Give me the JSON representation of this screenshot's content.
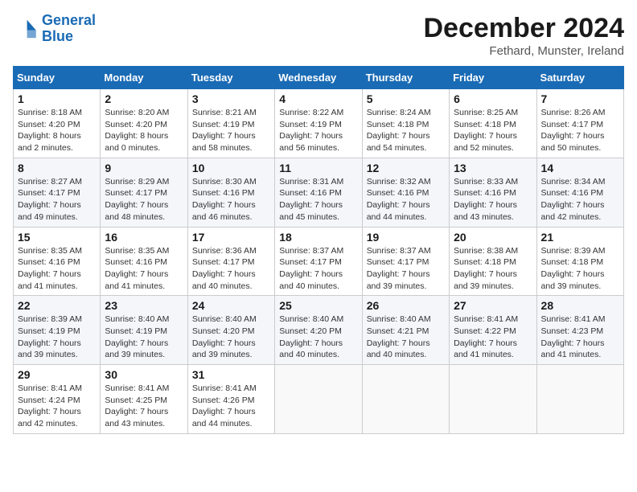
{
  "logo": {
    "line1": "General",
    "line2": "Blue"
  },
  "title": "December 2024",
  "location": "Fethard, Munster, Ireland",
  "days_of_week": [
    "Sunday",
    "Monday",
    "Tuesday",
    "Wednesday",
    "Thursday",
    "Friday",
    "Saturday"
  ],
  "weeks": [
    [
      {
        "day": "1",
        "info": "Sunrise: 8:18 AM\nSunset: 4:20 PM\nDaylight: 8 hours\nand 2 minutes."
      },
      {
        "day": "2",
        "info": "Sunrise: 8:20 AM\nSunset: 4:20 PM\nDaylight: 8 hours\nand 0 minutes."
      },
      {
        "day": "3",
        "info": "Sunrise: 8:21 AM\nSunset: 4:19 PM\nDaylight: 7 hours\nand 58 minutes."
      },
      {
        "day": "4",
        "info": "Sunrise: 8:22 AM\nSunset: 4:19 PM\nDaylight: 7 hours\nand 56 minutes."
      },
      {
        "day": "5",
        "info": "Sunrise: 8:24 AM\nSunset: 4:18 PM\nDaylight: 7 hours\nand 54 minutes."
      },
      {
        "day": "6",
        "info": "Sunrise: 8:25 AM\nSunset: 4:18 PM\nDaylight: 7 hours\nand 52 minutes."
      },
      {
        "day": "7",
        "info": "Sunrise: 8:26 AM\nSunset: 4:17 PM\nDaylight: 7 hours\nand 50 minutes."
      }
    ],
    [
      {
        "day": "8",
        "info": "Sunrise: 8:27 AM\nSunset: 4:17 PM\nDaylight: 7 hours\nand 49 minutes."
      },
      {
        "day": "9",
        "info": "Sunrise: 8:29 AM\nSunset: 4:17 PM\nDaylight: 7 hours\nand 48 minutes."
      },
      {
        "day": "10",
        "info": "Sunrise: 8:30 AM\nSunset: 4:16 PM\nDaylight: 7 hours\nand 46 minutes."
      },
      {
        "day": "11",
        "info": "Sunrise: 8:31 AM\nSunset: 4:16 PM\nDaylight: 7 hours\nand 45 minutes."
      },
      {
        "day": "12",
        "info": "Sunrise: 8:32 AM\nSunset: 4:16 PM\nDaylight: 7 hours\nand 44 minutes."
      },
      {
        "day": "13",
        "info": "Sunrise: 8:33 AM\nSunset: 4:16 PM\nDaylight: 7 hours\nand 43 minutes."
      },
      {
        "day": "14",
        "info": "Sunrise: 8:34 AM\nSunset: 4:16 PM\nDaylight: 7 hours\nand 42 minutes."
      }
    ],
    [
      {
        "day": "15",
        "info": "Sunrise: 8:35 AM\nSunset: 4:16 PM\nDaylight: 7 hours\nand 41 minutes."
      },
      {
        "day": "16",
        "info": "Sunrise: 8:35 AM\nSunset: 4:16 PM\nDaylight: 7 hours\nand 41 minutes."
      },
      {
        "day": "17",
        "info": "Sunrise: 8:36 AM\nSunset: 4:17 PM\nDaylight: 7 hours\nand 40 minutes."
      },
      {
        "day": "18",
        "info": "Sunrise: 8:37 AM\nSunset: 4:17 PM\nDaylight: 7 hours\nand 40 minutes."
      },
      {
        "day": "19",
        "info": "Sunrise: 8:37 AM\nSunset: 4:17 PM\nDaylight: 7 hours\nand 39 minutes."
      },
      {
        "day": "20",
        "info": "Sunrise: 8:38 AM\nSunset: 4:18 PM\nDaylight: 7 hours\nand 39 minutes."
      },
      {
        "day": "21",
        "info": "Sunrise: 8:39 AM\nSunset: 4:18 PM\nDaylight: 7 hours\nand 39 minutes."
      }
    ],
    [
      {
        "day": "22",
        "info": "Sunrise: 8:39 AM\nSunset: 4:19 PM\nDaylight: 7 hours\nand 39 minutes."
      },
      {
        "day": "23",
        "info": "Sunrise: 8:40 AM\nSunset: 4:19 PM\nDaylight: 7 hours\nand 39 minutes."
      },
      {
        "day": "24",
        "info": "Sunrise: 8:40 AM\nSunset: 4:20 PM\nDaylight: 7 hours\nand 39 minutes."
      },
      {
        "day": "25",
        "info": "Sunrise: 8:40 AM\nSunset: 4:20 PM\nDaylight: 7 hours\nand 40 minutes."
      },
      {
        "day": "26",
        "info": "Sunrise: 8:40 AM\nSunset: 4:21 PM\nDaylight: 7 hours\nand 40 minutes."
      },
      {
        "day": "27",
        "info": "Sunrise: 8:41 AM\nSunset: 4:22 PM\nDaylight: 7 hours\nand 41 minutes."
      },
      {
        "day": "28",
        "info": "Sunrise: 8:41 AM\nSunset: 4:23 PM\nDaylight: 7 hours\nand 41 minutes."
      }
    ],
    [
      {
        "day": "29",
        "info": "Sunrise: 8:41 AM\nSunset: 4:24 PM\nDaylight: 7 hours\nand 42 minutes."
      },
      {
        "day": "30",
        "info": "Sunrise: 8:41 AM\nSunset: 4:25 PM\nDaylight: 7 hours\nand 43 minutes."
      },
      {
        "day": "31",
        "info": "Sunrise: 8:41 AM\nSunset: 4:26 PM\nDaylight: 7 hours\nand 44 minutes."
      },
      {
        "day": "",
        "info": ""
      },
      {
        "day": "",
        "info": ""
      },
      {
        "day": "",
        "info": ""
      },
      {
        "day": "",
        "info": ""
      }
    ]
  ]
}
